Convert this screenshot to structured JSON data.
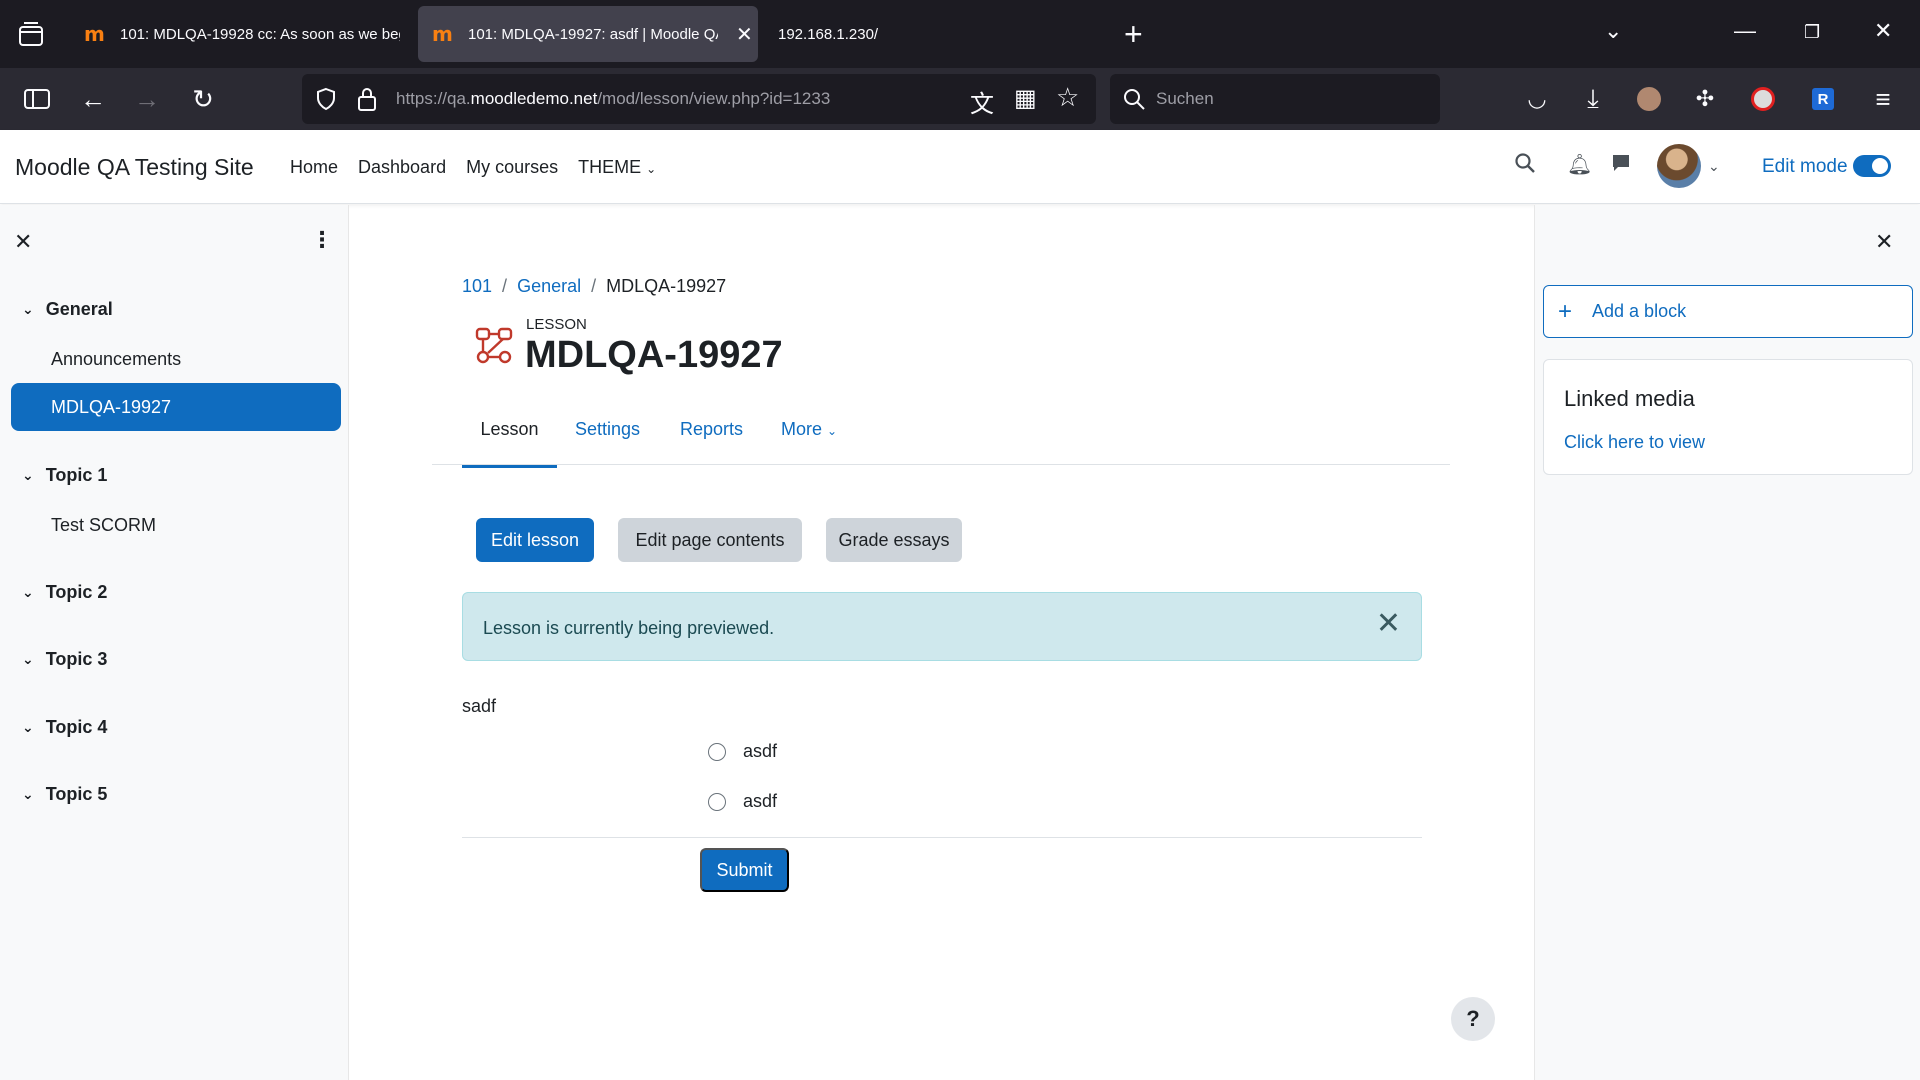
{
  "browser": {
    "tabs": [
      {
        "title": "101: MDLQA-19928 cc: As soon as we beg"
      },
      {
        "title": "101: MDLQA-19927: asdf | Moodle QA"
      },
      {
        "title": "192.168.1.230/"
      }
    ],
    "url_prefix": "https://qa.",
    "url_domain": "moodledemo.net",
    "url_path": "/mod/lesson/view.php?id=1233",
    "search_placeholder": "Suchen"
  },
  "header": {
    "site_name": "Moodle QA Testing Site",
    "nav": [
      "Home",
      "Dashboard",
      "My courses",
      "THEME"
    ],
    "edit_mode_label": "Edit mode",
    "edit_mode_on": true
  },
  "course_index": {
    "sections": [
      {
        "title": "General",
        "activities": [
          "Announcements",
          "MDLQA-19927"
        ]
      },
      {
        "title": "Topic 1",
        "activities": [
          "Test SCORM"
        ]
      },
      {
        "title": "Topic 2",
        "activities": []
      },
      {
        "title": "Topic 3",
        "activities": []
      },
      {
        "title": "Topic 4",
        "activities": []
      },
      {
        "title": "Topic 5",
        "activities": []
      }
    ],
    "active_activity": "MDLQA-19927"
  },
  "main": {
    "breadcrumb": [
      "101",
      "General",
      "MDLQA-19927"
    ],
    "activity_type": "LESSON",
    "title": "MDLQA-19927",
    "tabs": [
      "Lesson",
      "Settings",
      "Reports",
      "More"
    ],
    "active_tab": "Lesson",
    "buttons": {
      "edit_lesson": "Edit lesson",
      "edit_page_contents": "Edit page contents",
      "grade_essays": "Grade essays"
    },
    "alert": "Lesson is currently being previewed.",
    "question": "sadf",
    "answers": [
      "asdf",
      "asdf"
    ],
    "submit": "Submit",
    "help": "?"
  },
  "blocks": {
    "add_block": "Add a block",
    "linked_media": {
      "title": "Linked media",
      "link": "Click here to view"
    }
  },
  "colors": {
    "primary": "#0f6cbf",
    "alert_bg": "#cfe8ed",
    "chrome_dark": "#1c1b22"
  }
}
